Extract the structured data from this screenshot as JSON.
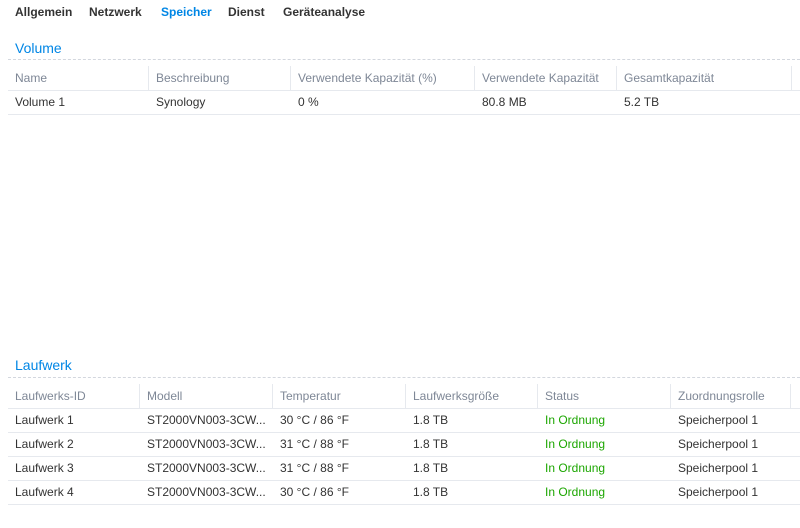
{
  "tabs": [
    {
      "label": "Allgemein",
      "active": false
    },
    {
      "label": "Netzwerk",
      "active": false
    },
    {
      "label": "Speicher",
      "active": true
    },
    {
      "label": "Dienst",
      "active": false
    },
    {
      "label": "Geräteanalyse",
      "active": false
    }
  ],
  "volume": {
    "title": "Volume",
    "columns": [
      "Name",
      "Beschreibung",
      "Verwendete Kapazität (%)",
      "Verwendete Kapazität",
      "Gesamtkapazität"
    ],
    "rows": [
      [
        "Volume 1",
        "Synology",
        "0 %",
        "80.8 MB",
        "5.2 TB"
      ]
    ]
  },
  "drives": {
    "title": "Laufwerk",
    "columns": [
      "Laufwerks-ID",
      "Modell",
      "Temperatur",
      "Laufwerksgröße",
      "Status",
      "Zuordnungsrolle"
    ],
    "rows": [
      [
        "Laufwerk 1",
        "ST2000VN003-3CW...",
        "30 °C / 86 °F",
        "1.8 TB",
        "In Ordnung",
        "Speicherpool 1"
      ],
      [
        "Laufwerk 2",
        "ST2000VN003-3CW...",
        "31 °C / 88 °F",
        "1.8 TB",
        "In Ordnung",
        "Speicherpool 1"
      ],
      [
        "Laufwerk 3",
        "ST2000VN003-3CW...",
        "31 °C / 88 °F",
        "1.8 TB",
        "In Ordnung",
        "Speicherpool 1"
      ],
      [
        "Laufwerk 4",
        "ST2000VN003-3CW...",
        "30 °C / 86 °F",
        "1.8 TB",
        "In Ordnung",
        "Speicherpool 1"
      ]
    ]
  },
  "colors": {
    "accent": "#0086e5",
    "status_ok": "#1ca600"
  }
}
